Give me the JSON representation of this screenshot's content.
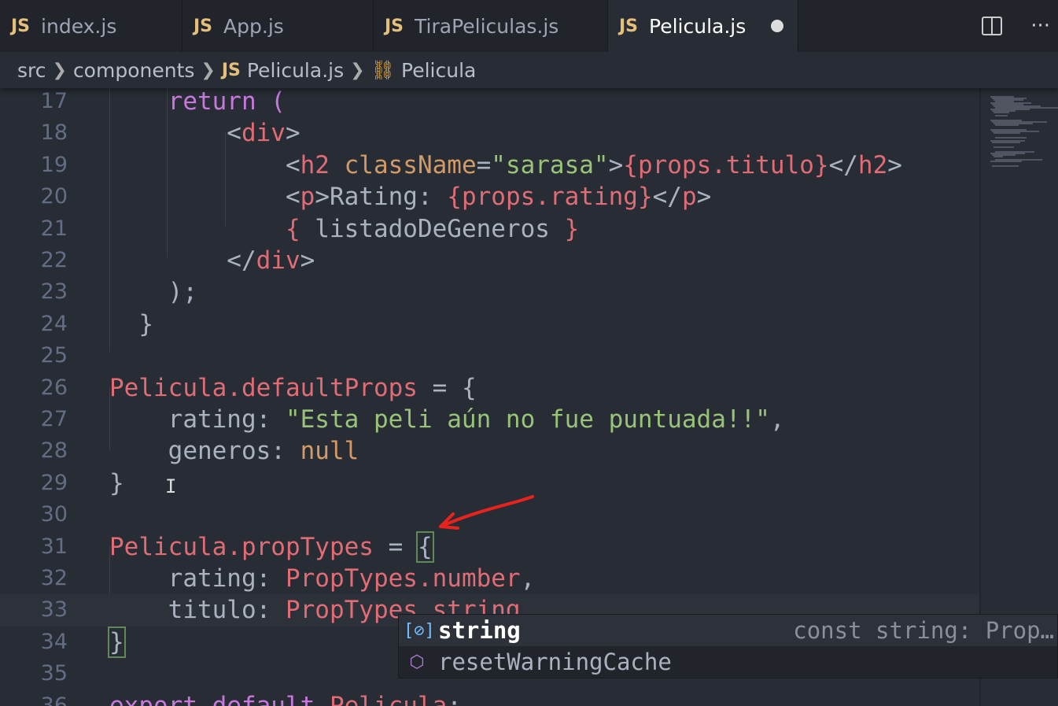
{
  "tabs": [
    {
      "icon": "JS",
      "label": "index.js",
      "active": false
    },
    {
      "icon": "JS",
      "label": "App.js",
      "active": false
    },
    {
      "icon": "JS",
      "label": "TiraPeliculas.js",
      "active": false
    },
    {
      "icon": "JS",
      "label": "Pelicula.js",
      "active": true,
      "modified": true
    }
  ],
  "tab_actions": {
    "split": "split-editor-icon",
    "more": "···"
  },
  "breadcrumb": {
    "items": [
      "src",
      "components",
      "Pelicula.js",
      "Pelicula"
    ],
    "file_icon": "JS",
    "symbol_icon": "symbol-class-icon"
  },
  "colors": {
    "background": "#282c34",
    "tag": "#e06c75",
    "attr": "#d19a66",
    "string": "#98c379",
    "keyword": "#c678dd",
    "annotation": "#e8231e"
  },
  "editor": {
    "current_line": 33,
    "lines": [
      {
        "n": "17",
        "tokens": [
          [
            "    return (",
            "kw"
          ]
        ]
      },
      {
        "n": "18",
        "tokens": [
          [
            "        <",
            "p"
          ],
          [
            "div",
            "tag"
          ],
          [
            ">",
            "p"
          ]
        ]
      },
      {
        "n": "19",
        "tokens": [
          [
            "            <",
            "p"
          ],
          [
            "h2",
            "tag"
          ],
          [
            " className",
            "attr"
          ],
          [
            "=",
            "p"
          ],
          [
            "\"sarasa\"",
            "str"
          ],
          [
            ">",
            "p"
          ],
          [
            "{",
            "br"
          ],
          [
            "props.titulo",
            "id"
          ],
          [
            "}",
            "br"
          ],
          [
            "</",
            "p"
          ],
          [
            "h2",
            "tag"
          ],
          [
            ">",
            "p"
          ]
        ]
      },
      {
        "n": "20",
        "tokens": [
          [
            "            <",
            "p"
          ],
          [
            "p",
            "tag"
          ],
          [
            ">Rating: ",
            "p"
          ],
          [
            "{",
            "br"
          ],
          [
            "props.rating",
            "id"
          ],
          [
            "}",
            "br"
          ],
          [
            "</",
            "p"
          ],
          [
            "p",
            "tag"
          ],
          [
            ">",
            "p"
          ]
        ]
      },
      {
        "n": "21",
        "tokens": [
          [
            "            ",
            "p"
          ],
          [
            "{",
            "br"
          ],
          [
            " listadoDeGeneros ",
            "p"
          ],
          [
            "}",
            "br"
          ]
        ]
      },
      {
        "n": "22",
        "tokens": [
          [
            "        </",
            "p"
          ],
          [
            "div",
            "tag"
          ],
          [
            ">",
            "p"
          ]
        ]
      },
      {
        "n": "23",
        "tokens": [
          [
            "    );",
            "p"
          ]
        ]
      },
      {
        "n": "24",
        "tokens": [
          [
            "  }",
            "p"
          ]
        ]
      },
      {
        "n": "25",
        "tokens": []
      },
      {
        "n": "26",
        "tokens": [
          [
            "Pelicula",
            "id"
          ],
          [
            ".defaultProps",
            "id"
          ],
          [
            " = {",
            "p"
          ]
        ]
      },
      {
        "n": "27",
        "tokens": [
          [
            "    rating: ",
            "p"
          ],
          [
            "\"Esta peli aún no fue puntuada!!\"",
            "str"
          ],
          [
            ",",
            "p"
          ]
        ]
      },
      {
        "n": "28",
        "tokens": [
          [
            "    generos: ",
            "p"
          ],
          [
            "null",
            "num"
          ]
        ]
      },
      {
        "n": "29",
        "tokens": [
          [
            "}",
            "p"
          ]
        ]
      },
      {
        "n": "30",
        "tokens": []
      },
      {
        "n": "31",
        "tokens": [
          [
            "Pelicula",
            "id"
          ],
          [
            ".propTypes",
            "id"
          ],
          [
            " = ",
            "p"
          ],
          [
            "{",
            "match"
          ]
        ]
      },
      {
        "n": "32",
        "tokens": [
          [
            "    rating: ",
            "p"
          ],
          [
            "PropTypes",
            "id"
          ],
          [
            ".number",
            "id"
          ],
          [
            ",",
            "p"
          ]
        ]
      },
      {
        "n": "33",
        "tokens": [
          [
            "    titulo: ",
            "p"
          ],
          [
            "PropTypes",
            "id"
          ],
          [
            ".string",
            "id"
          ]
        ]
      },
      {
        "n": "34",
        "tokens": [
          [
            "}",
            "match"
          ]
        ]
      },
      {
        "n": "35",
        "tokens": []
      },
      {
        "n": "36",
        "tokens": [
          [
            "export default ",
            "kw"
          ],
          [
            "Pelicula",
            "id"
          ],
          [
            ";",
            "p"
          ]
        ]
      }
    ]
  },
  "suggest": {
    "items": [
      {
        "icon": "variable-icon",
        "label": "string",
        "detail": "const string: Prop…",
        "selected": true
      },
      {
        "icon": "module-cube-icon",
        "label": "resetWarningCache",
        "detail": "",
        "selected": false
      }
    ]
  }
}
